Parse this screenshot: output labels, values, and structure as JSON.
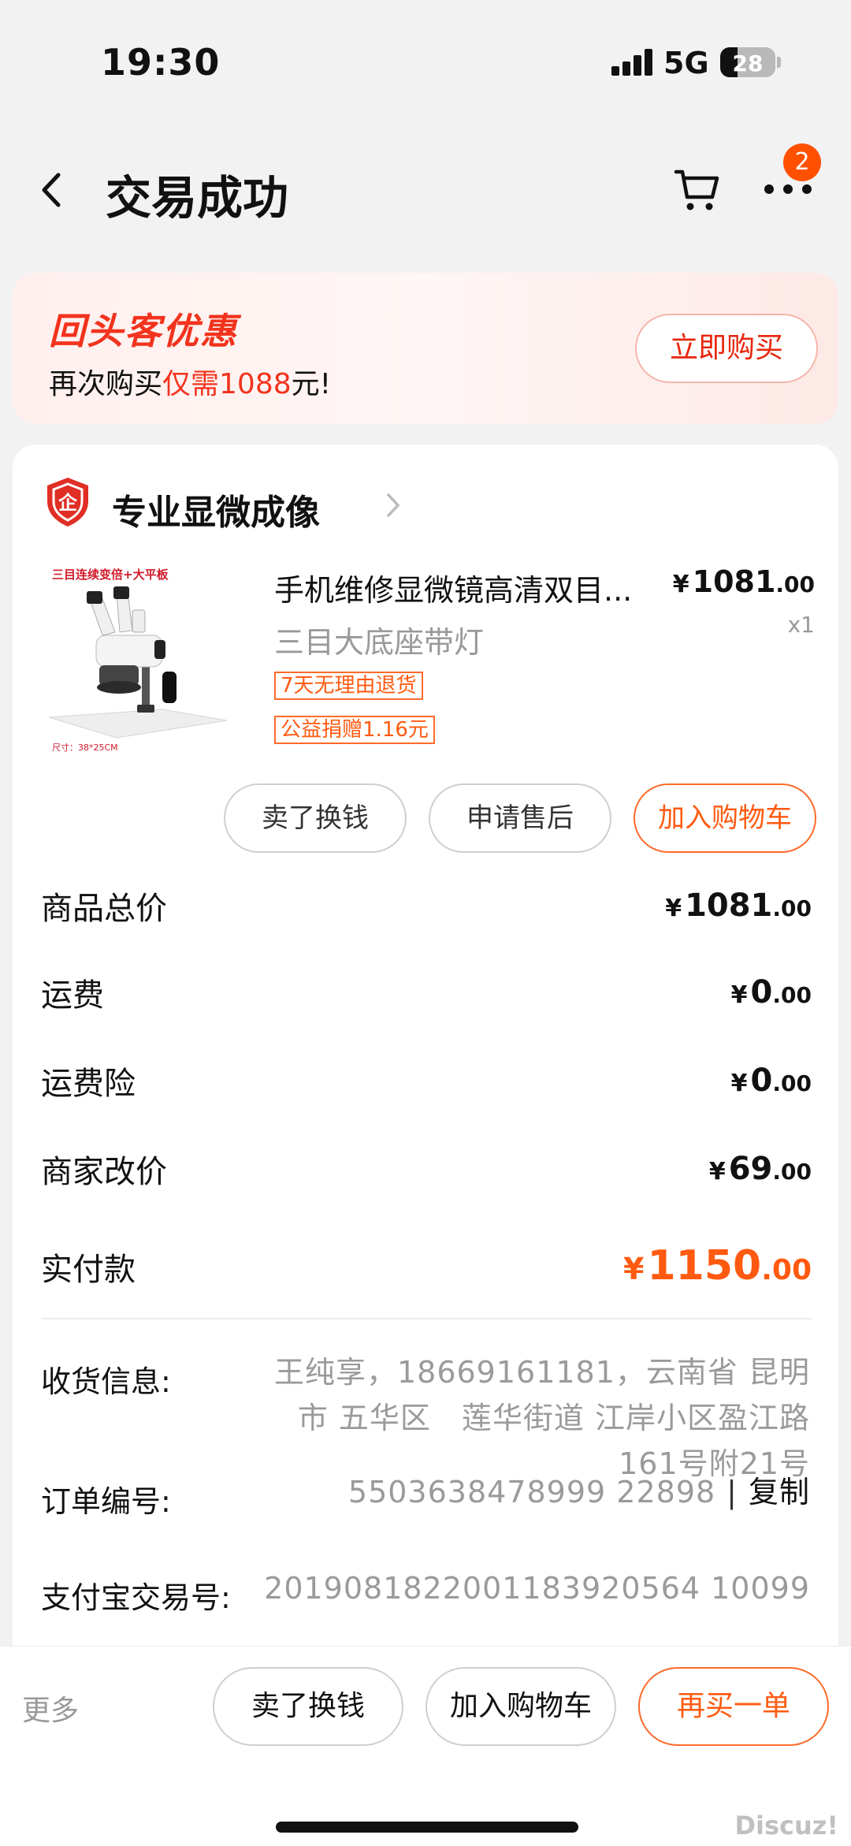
{
  "status_bar": {
    "time": "19:30",
    "network": "5G",
    "battery": "28"
  },
  "header": {
    "title": "交易成功",
    "badge_count": "2"
  },
  "promo": {
    "title": "回头客优惠",
    "text_prefix": "再次购买",
    "text_highlight": "仅需",
    "text_price": "1088",
    "text_suffix": "元!",
    "button_label": "立即购买"
  },
  "shop": {
    "name": "专业显微成像"
  },
  "product": {
    "image_caption_top": "三目连续变倍+大平板",
    "image_caption_bottom": "尺寸：38*25CM",
    "title": "手机维修显微镜高清双目...",
    "spec": "三目大底座带灯",
    "tags": [
      "7天无理由退货",
      "公益捐赠1.16元"
    ],
    "price_yen": "¥",
    "price_int": "1081",
    "price_dec": ".00",
    "qty": "x1"
  },
  "item_actions": [
    "卖了换钱",
    "申请售后",
    "加入购物车"
  ],
  "summary": [
    {
      "label": "商品总价",
      "yen": "¥",
      "int": "1081",
      "dec": ".00"
    },
    {
      "label": "运费",
      "yen": "¥",
      "int": "0",
      "dec": ".00"
    },
    {
      "label": "运费险",
      "yen": "¥",
      "int": "0",
      "dec": ".00"
    },
    {
      "label": "商家改价",
      "yen": "¥",
      "int": "69",
      "dec": ".00"
    },
    {
      "label": "实付款",
      "yen": "¥",
      "int": "1150",
      "dec": ".00"
    }
  ],
  "info": {
    "address_label": "收货信息:",
    "address_lines": [
      "王纯享，18669161181，云南省 昆明",
      "市 五华区　莲华街道 江岸小区盈江路",
      "161号附21号"
    ],
    "order_label": "订单编号:",
    "order_value": "5503638478999 22898",
    "copy_sep": "|",
    "copy_label": "复制",
    "alipay_label": "支付宝交易号:",
    "alipay_value": "2019081822001183920564 10099"
  },
  "bottom_bar": {
    "more": "更多",
    "buttons": [
      "卖了换钱",
      "加入购物车",
      "再买一单"
    ]
  },
  "watermark": "Discuz!",
  "colors": {
    "accent": "#ff5000",
    "promo_red": "#f2331d",
    "muted": "#999999"
  }
}
